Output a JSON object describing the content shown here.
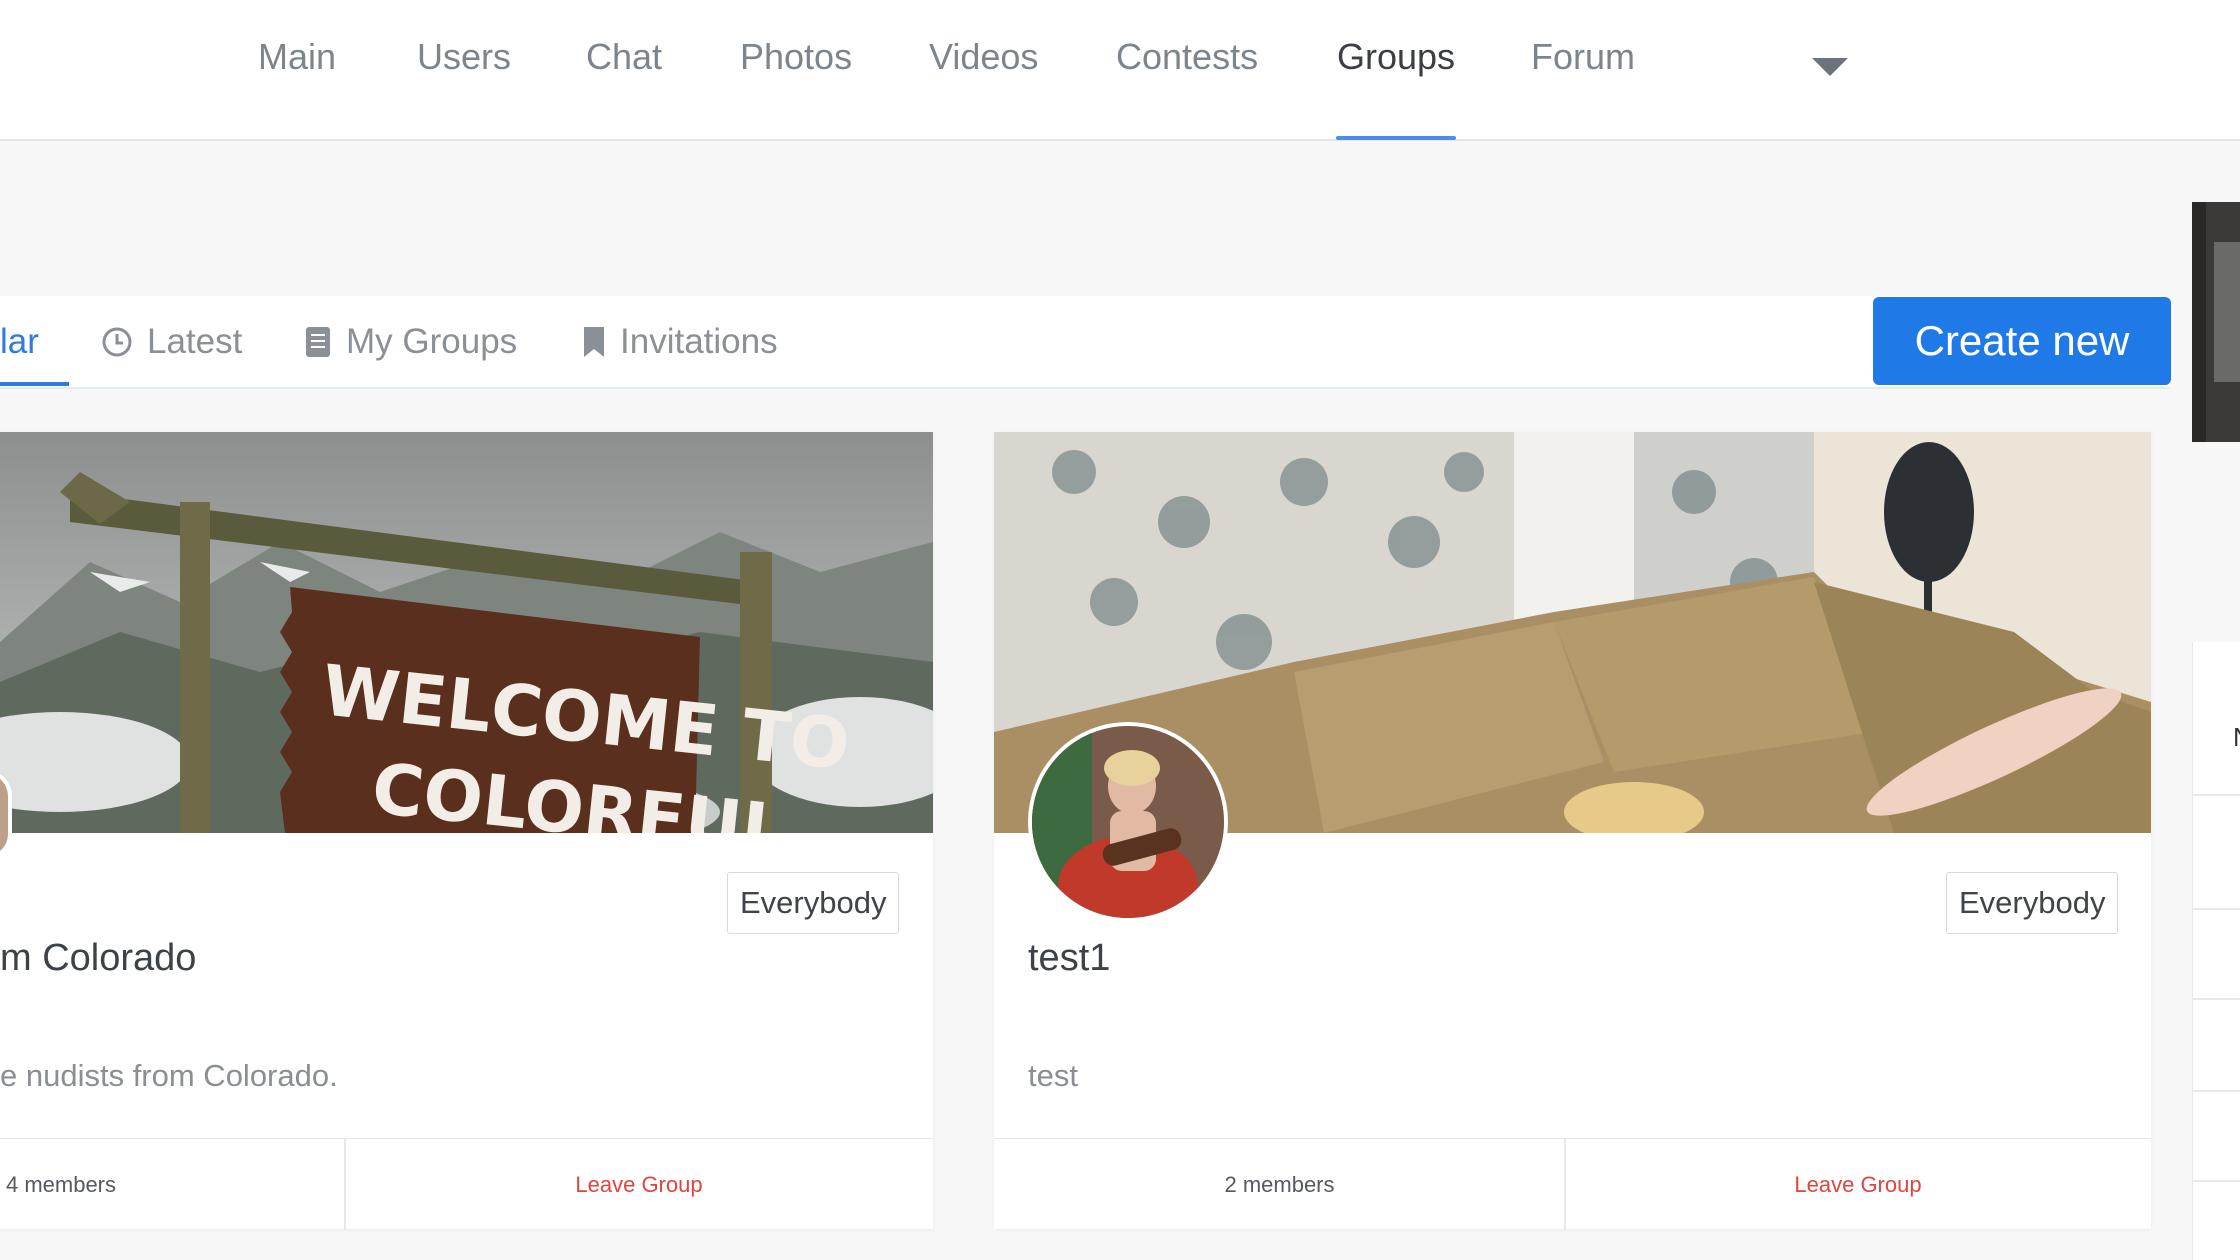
{
  "nav": {
    "items": [
      {
        "label": "Main"
      },
      {
        "label": "Users"
      },
      {
        "label": "Chat"
      },
      {
        "label": "Photos"
      },
      {
        "label": "Videos"
      },
      {
        "label": "Contests"
      },
      {
        "label": "Groups",
        "active": true
      },
      {
        "label": "Forum"
      }
    ],
    "more_icon": "caret-down-icon"
  },
  "tabs": {
    "items": [
      {
        "label": "lar",
        "icon": "",
        "active": true
      },
      {
        "label": "Latest",
        "icon": "clock-icon"
      },
      {
        "label": "My Groups",
        "icon": "document-icon"
      },
      {
        "label": "Invitations",
        "icon": "bookmark-icon"
      }
    ],
    "create_label": "Create new"
  },
  "groups": [
    {
      "title": "m Colorado",
      "description": "e nudists from Colorado.",
      "badge": "Everybody",
      "members": "4 members",
      "leave_label": "Leave Group",
      "cover_text_line1": "WELCOME TO",
      "cover_text_line2": "COLORFUL"
    },
    {
      "title": "test1",
      "description": "test",
      "badge": "Everybody",
      "members": "2 members",
      "leave_label": "Leave Group"
    }
  ],
  "colors": {
    "accent": "#1f7ae8",
    "leave": "#e0443e",
    "nav_active_underline": "#4a8fe7"
  }
}
